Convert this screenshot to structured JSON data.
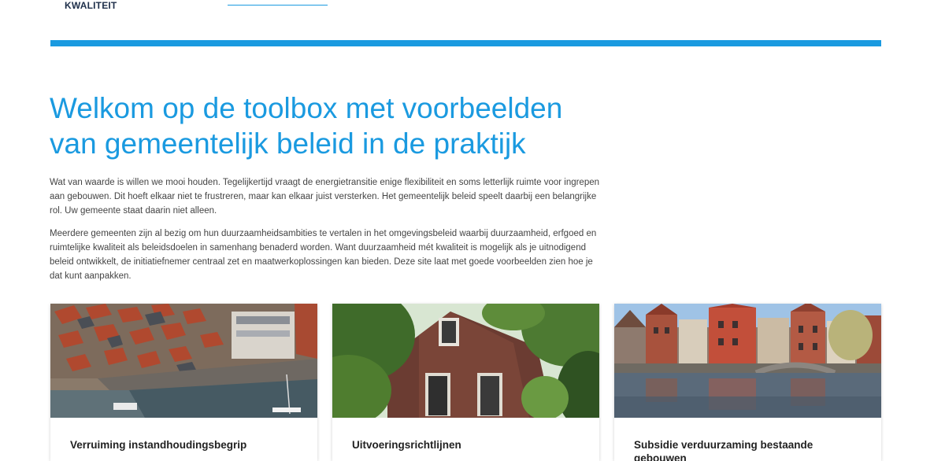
{
  "header": {
    "logo_text": "KWALITEIT"
  },
  "hero": {
    "title": "Welkom op de toolbox met voorbeelden van gemeentelijk beleid in de praktijk",
    "paragraph1": "Wat van waarde is willen we mooi houden. Tegelijkertijd vraagt de energietransitie enige flexibiliteit en soms letterlijk ruimte voor ingrepen aan gebouwen. Dit hoeft elkaar niet te frustreren, maar kan elkaar juist versterken. Het gemeentelijk beleid speelt daarbij een belangrijke rol. Uw gemeente staat daarin niet alleen.",
    "paragraph2": "Meerdere gemeenten zijn al bezig om hun duurzaamheidsambities te vertalen in het omgevingsbeleid waarbij duurzaamheid, erfgoed en ruimtelijke kwaliteit als beleidsdoelen in samenhang benaderd worden. Want duurzaamheid mét kwaliteit is mogelijk als je uitnodigend beleid ontwikkelt, de initiatiefnemer centraal zet en maatwerkoplossingen kan bieden. Deze site laat met goede voorbeelden zien hoe je dat kunt aanpakken."
  },
  "cards": [
    {
      "title": "Verruiming instandhoudingsbegrip",
      "image": "aerial-town-harbour-photo"
    },
    {
      "title": "Uitvoeringsrichtlijnen",
      "image": "old-brick-house-photo"
    },
    {
      "title": "Subsidie verduurzaming bestaande gebouwen",
      "image": "canal-houses-photo"
    }
  ],
  "colors": {
    "accent": "#1a9ae0",
    "logo": "#1e2f4a"
  }
}
